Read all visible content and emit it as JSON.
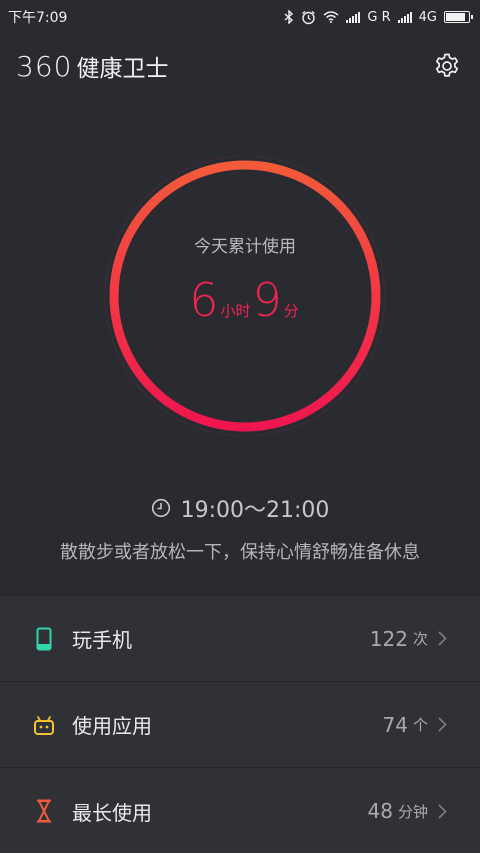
{
  "status_bar": {
    "time": "下午7:09",
    "carrier_text": "G R",
    "network": "4G",
    "battery_level": 0.85,
    "icons": [
      "bluetooth-icon",
      "alarm-icon",
      "wifi-icon",
      "signal-icon",
      "battery-icon"
    ]
  },
  "header": {
    "brand_number": "360",
    "brand_text": "健康卫士",
    "settings_icon": "gear-icon"
  },
  "usage": {
    "label": "今天累计使用",
    "hours": "6",
    "hours_unit": "小时",
    "minutes": "9",
    "minutes_unit": "分",
    "ring_color_start": "#f35a3a",
    "ring_color_end": "#f0164f"
  },
  "schedule": {
    "time_range": "19:00〜21:00",
    "tip": "散散步或者放松一下，保持心情舒畅准备休息",
    "icon": "clock-icon"
  },
  "stats": [
    {
      "icon": "phone-icon",
      "icon_color": "#2fd6a8",
      "label": "玩手机",
      "value": "122",
      "unit": "次"
    },
    {
      "icon": "android-icon",
      "icon_color": "#f2c230",
      "label": "使用应用",
      "value": "74",
      "unit": "个"
    },
    {
      "icon": "hourglass-icon",
      "icon_color": "#ee5b3b",
      "label": "最长使用",
      "value": "48",
      "unit": "分钟"
    }
  ],
  "colors": {
    "background": "#2a2b31",
    "list_background": "#303137",
    "accent": "#f0244f"
  }
}
